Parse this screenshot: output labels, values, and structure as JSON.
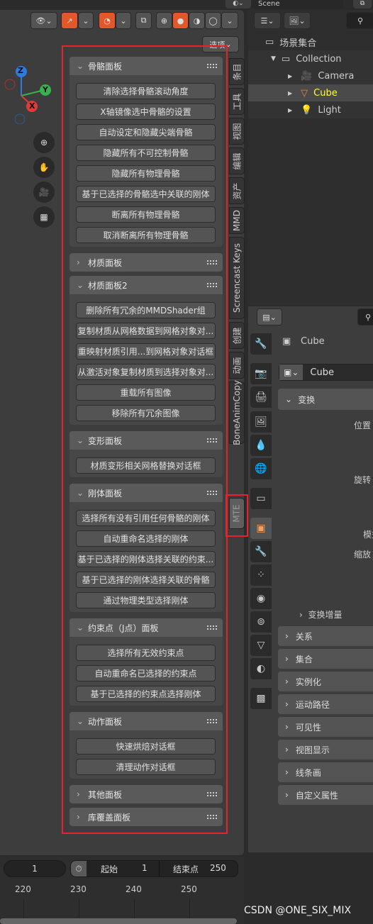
{
  "header": {
    "options_label": "选项",
    "scene_label": "Scene"
  },
  "gizmo": {
    "x": "X",
    "y": "Y",
    "z": "Z"
  },
  "side_tabs": [
    "条目",
    "工具",
    "视图",
    "编辑",
    "资产",
    "MMD",
    "Screencast Keys",
    "创建",
    "动画",
    "BoneAnimCopy",
    "MTE"
  ],
  "active_tab": "MTE",
  "panels": [
    {
      "title": "骨骼面板",
      "open": true,
      "buttons": [
        "清除选择骨骼滚动角度",
        "X轴镜像选中骨骼的设置",
        "自动设定和隐藏尖端骨骼",
        "隐藏所有不可控制骨骼",
        "隐藏所有物理骨骼",
        "基于已选择的骨骼选中关联的刚体",
        "断离所有物理骨骼",
        "取消断离所有物理骨骼"
      ]
    },
    {
      "title": "材质面板",
      "open": false,
      "buttons": []
    },
    {
      "title": "材质面板2",
      "open": true,
      "buttons": [
        "删除所有冗余的MMDShader组",
        "复制材质从网格数据到网格对象对...",
        "重映射材质引用...到网格对象对话框",
        "从激活对象复制材质到选择对象对...",
        "重载所有图像",
        "移除所有冗余图像"
      ]
    },
    {
      "title": "变形面板",
      "open": true,
      "buttons": [
        "材质变形相关网格替换对话框"
      ]
    },
    {
      "title": "刚体面板",
      "open": true,
      "buttons": [
        "选择所有没有引用任何骨骼的刚体",
        "自动重命名选择的刚体",
        "基于已选择的刚体选择关联的约束...",
        "基于已选择的刚体选择关联的骨骼",
        "通过物理类型选择刚体"
      ]
    },
    {
      "title": "约束点（J点）面板",
      "open": true,
      "buttons": [
        "选择所有无效约束点",
        "自动重命名已选择的约束点",
        "基于已选择的约束点选择刚体"
      ]
    },
    {
      "title": "动作面板",
      "open": true,
      "buttons": [
        "快速烘焙对话框",
        "清理动作对话框"
      ]
    },
    {
      "title": "其他面板",
      "open": false,
      "buttons": []
    },
    {
      "title": "库覆盖面板",
      "open": false,
      "buttons": []
    }
  ],
  "outliner": {
    "root": "场景集合",
    "collection": "Collection",
    "items": [
      {
        "name": "Camera",
        "icon": "camera-icon"
      },
      {
        "name": "Cube",
        "icon": "mesh-icon",
        "selected": true
      },
      {
        "name": "Light",
        "icon": "light-icon"
      }
    ]
  },
  "properties": {
    "object_name": "Cube",
    "datablock_name": "Cube",
    "transform_title": "变换",
    "labels": {
      "location": "位置",
      "rotation": "旋转",
      "mode": "模式",
      "scale": "缩放"
    },
    "delta": "变换增量",
    "sections": [
      "关系",
      "集合",
      "实例化",
      "运动路径",
      "可见性",
      "视图显示",
      "线条画",
      "自定义属性"
    ]
  },
  "timeline": {
    "current_frame": "1",
    "start_label": "起始",
    "start": "1",
    "end_label": "结束点",
    "end": "250",
    "ticks": [
      "220",
      "230",
      "240",
      "250"
    ]
  },
  "watermark": "CSDN @ONE_SIX_MIX",
  "colors": {
    "accent": "#e3582a",
    "highlight_box": "#e8222a",
    "selected_text": "#ffff33"
  }
}
